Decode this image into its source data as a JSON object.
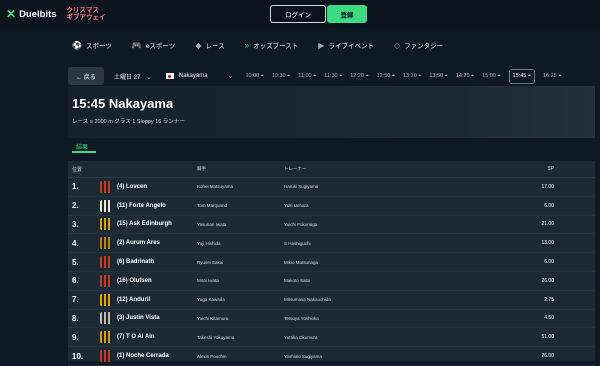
{
  "brand": {
    "name": "Duelbits",
    "promo_line1": "クリスマス",
    "promo_line2": "ギブアウェイ"
  },
  "auth": {
    "login": "ログイン",
    "register": "登録"
  },
  "nav": [
    {
      "label": "スポーツ",
      "icon": "sports-icon"
    },
    {
      "label": "eスポーツ",
      "icon": "gamepad-icon"
    },
    {
      "label": "レース",
      "icon": "racing-icon"
    },
    {
      "label": "オッズブースト",
      "icon": "boost-icon"
    },
    {
      "label": "ライブイベント",
      "icon": "live-icon"
    },
    {
      "label": "ファンタジー",
      "icon": "fantasy-icon"
    }
  ],
  "racebar": {
    "back": "← 戻る",
    "date": "土曜日 27",
    "track": "Nakayama",
    "times": [
      "10:00",
      "10:30",
      "11:00",
      "11:30",
      "12:20",
      "12:50",
      "13:20",
      "13:50",
      "14:20",
      "15:00",
      "15:45",
      "16:25"
    ],
    "active_time": "15:45"
  },
  "race": {
    "title": "15:45 Nakayama",
    "subtitle": "レース ≡  2000 m  クラス 1  Sloppy  16 ランナー"
  },
  "tabs": {
    "results": "結果"
  },
  "table": {
    "headers": {
      "pos": "位置",
      "jockey": "騎手",
      "trainer": "トレーナー",
      "sp": "SP"
    },
    "rows": [
      {
        "pos": "1.",
        "horse": "(4) Lovcen",
        "jockey": "Kohei Matsuyama",
        "trainer": "Haruki Sugiyama",
        "sp": "17.00",
        "silk_color": "#c0392b"
      },
      {
        "pos": "2.",
        "horse": "(11) Forte Angelo",
        "jockey": "Tom Marquand",
        "trainer": "Yuki Uehara",
        "sp": "6.00",
        "silk_color": "#e6e6e6"
      },
      {
        "pos": "3.",
        "horse": "(15) Ask Edinburgh",
        "jockey": "Yasunari Iwata",
        "trainer": "Yuichi Fukunaga",
        "sp": "21.00",
        "silk_color": "#d4a017"
      },
      {
        "pos": "4.",
        "horse": "(2) Aurum Ares",
        "jockey": "Yuji Hishida",
        "trainer": "S Hashiguchi",
        "sp": "13.00",
        "silk_color": "#b8860b"
      },
      {
        "pos": "5.",
        "horse": "(6) Badrinath",
        "jockey": "Ryusei Sakai",
        "trainer": "Mikio Matsunaga",
        "sp": "6.00",
        "silk_color": "#c0392b"
      },
      {
        "pos": "6.",
        "horse": "(16) Olufsen",
        "jockey": "Mirai Iwata",
        "trainer": "Makoto Saito",
        "sp": "26.00",
        "silk_color": "#c0392b"
      },
      {
        "pos": "7.",
        "horse": "(12) Anduril",
        "jockey": "Yuga Kawada",
        "trainer": "Mitsumasa Nakauchida",
        "sp": "2.75",
        "silk_color": "#e0a800"
      },
      {
        "pos": "8.",
        "horse": "(3) Justin Vista",
        "jockey": "Yuichi Kitamura",
        "trainer": "Tetsuya Yoshioka",
        "sp": "4.50",
        "silk_color": "#bbbbbb"
      },
      {
        "pos": "9.",
        "horse": "(7) T O Al Ain",
        "jockey": "Takeshi Yokoyama",
        "trainer": "Yutaka Okumura",
        "sp": "51.00",
        "silk_color": "#d4a017"
      },
      {
        "pos": "10.",
        "horse": "(1) Noche Cerrada",
        "jockey": "Alexis Pouchin",
        "trainer": "Yoshiaki Sugiyama",
        "sp": "26.00",
        "silk_color": "#c0392b"
      }
    ]
  }
}
